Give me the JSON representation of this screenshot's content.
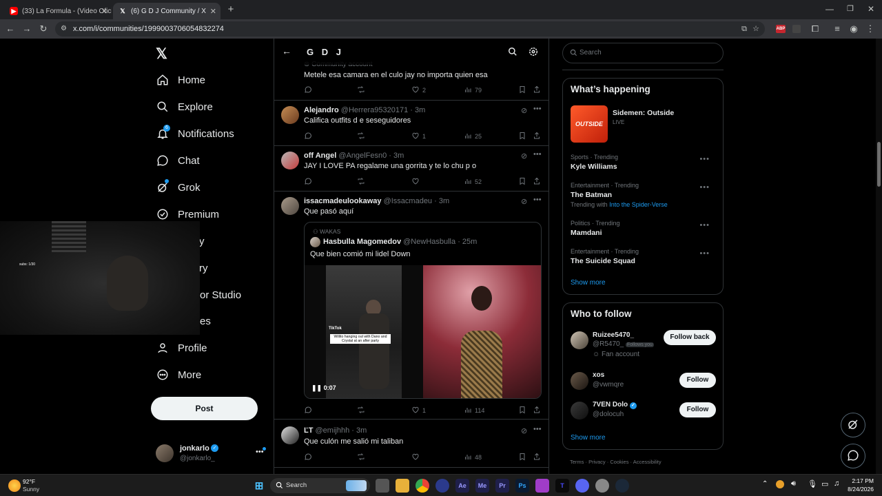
{
  "browser": {
    "tabs": [
      {
        "title": "(33) La Formula - (Video Oficial",
        "active": false
      },
      {
        "title": "(6) G D J Community / X",
        "active": true
      }
    ],
    "new_tab": "+",
    "url": "x.com/i/communities/1999003706054832274"
  },
  "sidebar": {
    "items": [
      {
        "label": "Home",
        "icon": "home-icon"
      },
      {
        "label": "Explore",
        "icon": "search-icon"
      },
      {
        "label": "Notifications",
        "icon": "bell-icon"
      },
      {
        "label": "Chat",
        "icon": "chat-icon"
      },
      {
        "label": "Grok",
        "icon": "grok-icon"
      },
      {
        "label": "Premium",
        "icon": "verified-icon"
      },
      {
        "label": "y"
      },
      {
        "label": "ry"
      },
      {
        "label": "or Studio"
      },
      {
        "label": "es"
      },
      {
        "label": "Profile",
        "icon": "person-icon"
      },
      {
        "label": "More",
        "icon": "more-circle-icon"
      }
    ],
    "post_button": "Post",
    "account": {
      "name": "jonkarlo",
      "handle": "@jonkarlo_"
    }
  },
  "webcam": {
    "overlay_text": "subs: 1/30"
  },
  "community": {
    "name": "G D J"
  },
  "tweets": [
    {
      "id": "t0",
      "community_label": "Community account",
      "text": "Metele esa camara en el culo jay no importa quien esa",
      "replies": "",
      "reposts": "",
      "likes": "2",
      "views": "79"
    },
    {
      "id": "t1",
      "name": "Alejandro",
      "handle": "@Herrera95320171",
      "time": "· 3m",
      "text": "Califica outfits d e seseguidores",
      "replies": "",
      "reposts": "",
      "likes": "1",
      "views": "25"
    },
    {
      "id": "t2",
      "name": "off Angel",
      "handle": "@AngelFesn0",
      "time": "· 3m",
      "text": "JAY I LOVE PA regalame una gorrita y te lo chu p o",
      "replies": "",
      "reposts": "",
      "likes": "",
      "views": "52"
    },
    {
      "id": "t3",
      "name": "issacmadeulookaway",
      "handle": "@Issacmadeu",
      "time": "· 3m",
      "text": "Que pasó aquí",
      "quote": {
        "community": "WAKAS",
        "name": "Hasbulla Magomedov",
        "handle": "@NewHasbulla",
        "time": "· 25m",
        "text": "Que bien comió mi lidel Down",
        "media_caption": "Willito hanging out with Dano and Crystal at an after party",
        "tiktok": "TikTok",
        "duration": "0:07"
      },
      "replies": "",
      "reposts": "",
      "likes": "1",
      "views": "114"
    },
    {
      "id": "t4",
      "name": "ĽT",
      "handle": "@emijhhh",
      "time": "· 3m",
      "text": "Que culón me salió mi taliban",
      "replies": "",
      "reposts": "",
      "likes": "",
      "views": "48"
    }
  ],
  "right": {
    "search_placeholder": "Search",
    "whats_happening": {
      "title": "What’s happening",
      "featured": {
        "title": "Sidemen: Outside",
        "status": "LIVE",
        "thumb_text": "OUTSIDE"
      },
      "trends": [
        {
          "context": "Sports · Trending",
          "title": "Kyle Williams",
          "extra_prefix": "",
          "extra_link": ""
        },
        {
          "context": "Entertainment · Trending",
          "title": "The Batman",
          "extra_prefix": "Trending with",
          "extra_link": "Into the Spider-Verse"
        },
        {
          "context": "Politics · Trending",
          "title": "Mamdani",
          "extra_prefix": "",
          "extra_link": ""
        },
        {
          "context": "Entertainment · Trending",
          "title": "The Suicide Squad",
          "extra_prefix": "",
          "extra_link": ""
        }
      ],
      "show_more": "Show more"
    },
    "who_to_follow": {
      "title": "Who to follow",
      "users": [
        {
          "name": "Ruizee5470_",
          "handle": "@R5470_",
          "follows_you": "Follows you",
          "note": "Fan account",
          "button": "Follow back"
        },
        {
          "name": "xos",
          "handle": "@vwmqre",
          "follows_you": "",
          "note": "",
          "button": "Follow"
        },
        {
          "name": "7VEN Dolo",
          "handle": "@dolocuh",
          "follows_you": "",
          "note": "",
          "button": "Follow"
        }
      ],
      "show_more": "Show more"
    },
    "footer": [
      "Terms",
      "Privacy",
      "Cookies",
      "Accessibility"
    ]
  },
  "taskbar": {
    "weather": {
      "temp": "92°F",
      "condition": "Sunny"
    },
    "search_label": "Search",
    "time": "2:17 PM",
    "date": "8/24/2026"
  },
  "colors": {
    "accent": "#1d9bf0",
    "background": "#000000",
    "border": "#2f3336",
    "muted": "#71767b"
  }
}
